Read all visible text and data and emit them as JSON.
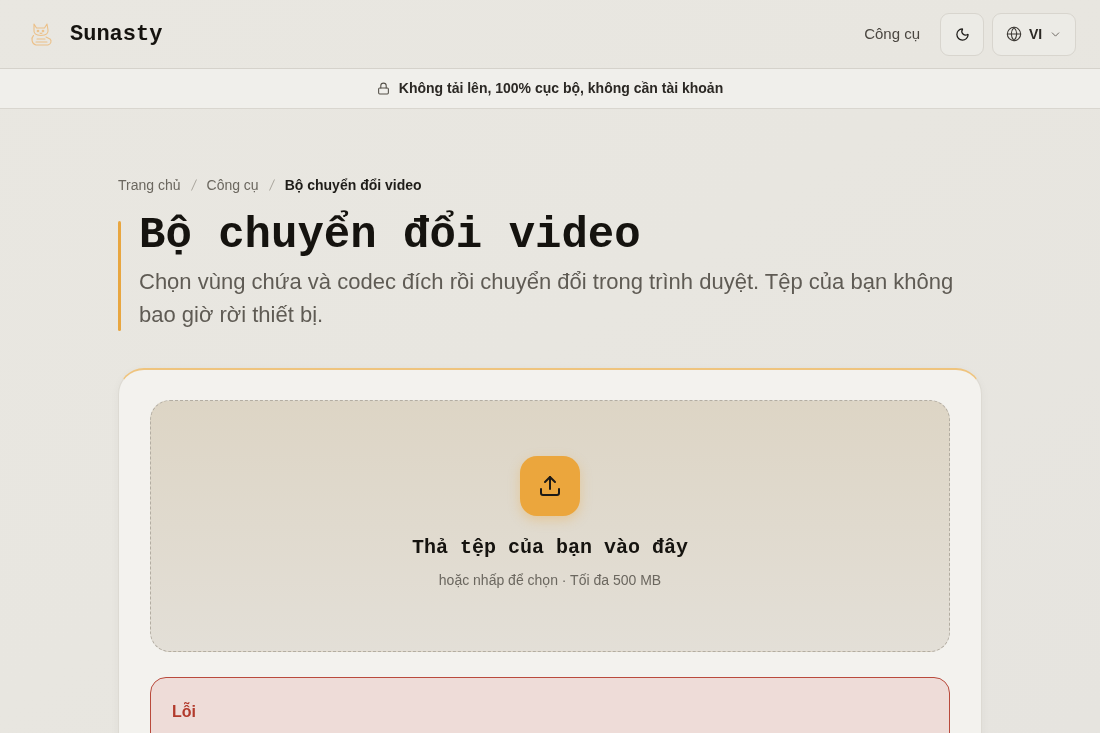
{
  "header": {
    "logo_text": "Sunasty",
    "nav_link": "Công cụ",
    "language": "VI"
  },
  "banner": {
    "text": "Không tải lên, 100% cục bộ, không cần tài khoản"
  },
  "breadcrumb": [
    {
      "label": "Trang chủ",
      "current": false
    },
    {
      "label": "Công cụ",
      "current": false
    },
    {
      "label": "Bộ chuyển đổi video",
      "current": true
    }
  ],
  "page": {
    "title": "Bộ chuyển đổi video",
    "description": "Chọn vùng chứa và codec đích rồi chuyển đổi trong trình duyệt. Tệp của bạn không bao giờ rời thiết bị."
  },
  "dropzone": {
    "title": "Thả tệp của bạn vào đây",
    "hint": "hoặc nhấp để chọn · Tối đa 500 MB"
  },
  "error": {
    "title": "Lỗi"
  }
}
